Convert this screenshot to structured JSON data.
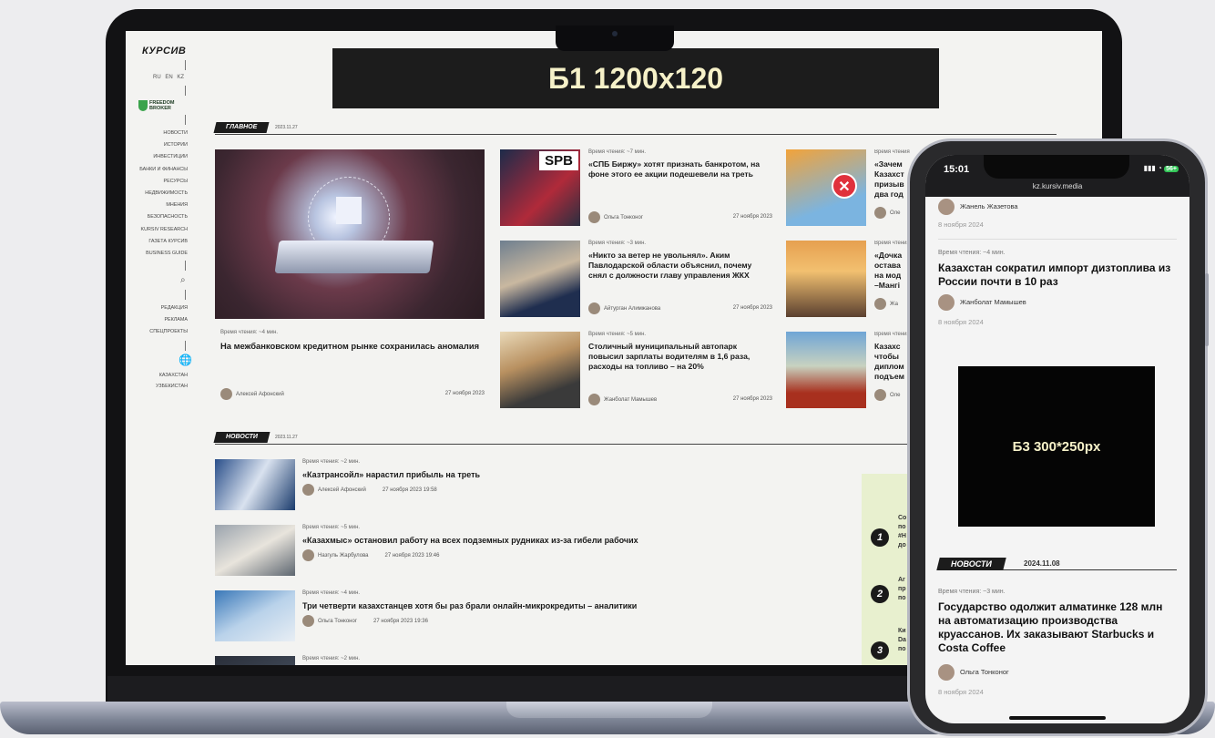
{
  "laptop": {
    "sidebar": {
      "logo": "КУРСИВ",
      "languages": "RU EN KZ",
      "partner": "FREEDOM\nBROKER",
      "nav": [
        "НОВОСТИ",
        "ИСТОРИИ",
        "ИНВЕСТИЦИИ",
        "БАНКИ И ФИНАНСЫ",
        "РЕСУРСЫ",
        "НЕДВИЖИМОСТЬ",
        "МНЕНИЯ",
        "БЕЗОПАСНОСТЬ",
        "KURSIV RESEARCH",
        "ГАЗЕТА КУРСИВ",
        "BUSINESS GUIDE"
      ],
      "nav2": [
        "РЕДАКЦИЯ",
        "РЕКЛАМА",
        "СПЕЦПРОЕКТЫ"
      ],
      "regions": [
        "КАЗАХСТАН",
        "УЗБЕКИСТАН"
      ],
      "search_icon": "search-icon",
      "globe_icon": "globe-icon"
    },
    "banner": "Б1 1200х120",
    "main_section": {
      "label": "ГЛАВНОЕ",
      "date": "2023.11.27"
    },
    "main_story": {
      "reading_time": "Время чтения: ~4 мин.",
      "title": "На межбанковском кредитном рынке сохранилась аномалия",
      "author": "Алексей Афонский",
      "date": "27 ноября 2023"
    },
    "stories": [
      {
        "reading_time": "Время чтения: ~7 мин.",
        "title": "«СПБ Биржу» хотят признать банкротом, на фоне этого ее акции подешевели на треть",
        "author": "Ольга Тонконог",
        "date": "27 ноября 2023",
        "thumb_text": "SPB"
      },
      {
        "reading_time": "Время чтения: ~3 мин.",
        "title": "«Никто за ветер не увольнял». Аким Павлодарской области объяснил, почему снял с должности главу управления ЖКХ",
        "author": "Айтурган Алимжанова",
        "date": "27 ноября 2023"
      },
      {
        "reading_time": "Время чтения: ~5 мин.",
        "title": "Столичный муниципальный автопарк повысил зарплаты водителям в 1,6 раза, расходы на топливо – на 20%",
        "author": "Жанболат Мамышев",
        "date": "27 ноября 2023"
      }
    ],
    "right_stories": [
      {
        "reading_time": "Время чтения",
        "title": "«Зачем Казахст призыв два год",
        "author": "Оле"
      },
      {
        "reading_time": "Время чтения",
        "title": "«Дочка остава на мод –Мангі",
        "author": "Жа"
      },
      {
        "reading_time": "Время чтения",
        "title": "Казахс чтобы диплом подъем",
        "author": "Оле"
      }
    ],
    "news_section": {
      "label": "НОВОСТИ",
      "date": "2023.11.27"
    },
    "news": [
      {
        "reading_time": "Время чтения: ~2 мин.",
        "title": "«Казтрансойл» нарастил прибыль на треть",
        "author": "Алексей Афонский",
        "date": "27 ноября 2023 19:58"
      },
      {
        "reading_time": "Время чтения: ~5 мин.",
        "title": "«Казахмыс» остановил работу на всех подземных рудниках из-за гибели рабочих",
        "author": "Назгуль Жарбулова",
        "date": "27 ноября 2023 19:46"
      },
      {
        "reading_time": "Время чтения: ~4 мин.",
        "title": "Три четверти казахстанцев хотя бы раз брали онлайн-микрокредиты – аналитики",
        "author": "Ольга Тонконог",
        "date": "27 ноября 2023 19:36"
      },
      {
        "reading_time": "Время чтения: ~2 мин.",
        "title": "",
        "author": "",
        "date": ""
      }
    ],
    "top_list": [
      {
        "num": "1",
        "text": "Co по #H до"
      },
      {
        "num": "2",
        "text": "Ar пр по"
      },
      {
        "num": "3",
        "text": "Ки Da по"
      }
    ]
  },
  "phone": {
    "time": "15:01",
    "battery": "56+",
    "url": "kz.kursiv.media",
    "items": [
      {
        "author": "Жанель Жазетова",
        "date": "8 ноября 2024"
      },
      {
        "reading_time": "Время чтения: ~4 мин.",
        "title": "Казахстан сократил импорт дизтоплива из России почти в 10 раз",
        "author": "Жанболат Мамышев",
        "date": "8 ноября 2024"
      }
    ],
    "ad": "Б3 300*250px",
    "section": {
      "label": "НОВОСТИ",
      "date": "2024.11.08"
    },
    "news": {
      "reading_time": "Время чтения: ~3 мин.",
      "title": "Государство одолжит алматинке 128 млн на автоматизацию производства круассанов. Их заказывают Starbucks и Costa Coffee",
      "author": "Ольга Тонконог",
      "date": "8 ноября 2024"
    }
  }
}
